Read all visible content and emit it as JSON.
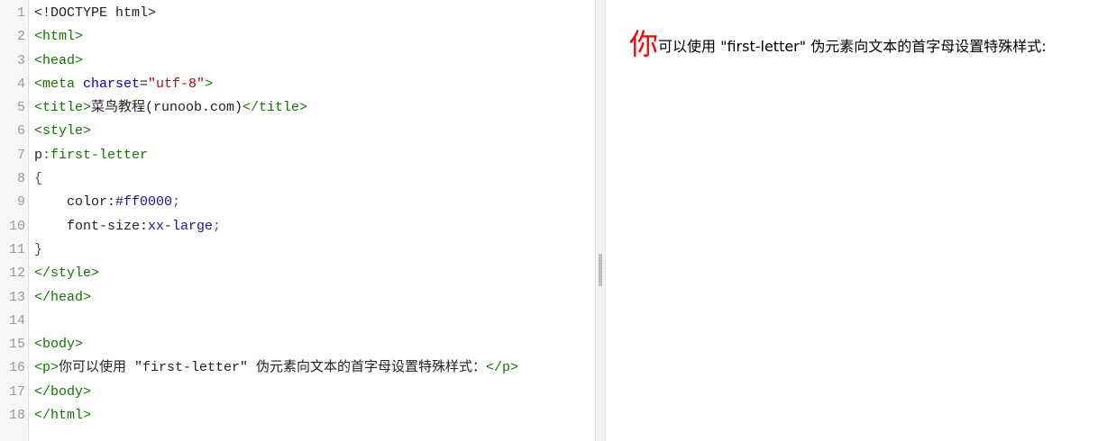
{
  "editor": {
    "line_numbers": [
      "1",
      "2",
      "3",
      "4",
      "5",
      "6",
      "7",
      "8",
      "9",
      "10",
      "11",
      "12",
      "13",
      "14",
      "15",
      "16",
      "17",
      "18"
    ],
    "lines": {
      "l1": {
        "text": "<!DOCTYPE html>"
      },
      "l2": {
        "text": "<html>"
      },
      "l3": {
        "text": "<head>"
      },
      "l4": {
        "tag_open": "<meta ",
        "attr": "charset",
        "eq": "=",
        "value": "\"utf-8\"",
        "tag_close": ">"
      },
      "l5": {
        "tag_open": "<title>",
        "content": "菜鸟教程(runoob.com)",
        "tag_close": "</title>"
      },
      "l6": {
        "text": "<style>"
      },
      "l7": {
        "selector": "p",
        "pseudo": ":first-letter"
      },
      "l8": {
        "text": "{"
      },
      "l9": {
        "indent": "    ",
        "prop": "color:",
        "value": "#ff0000",
        "semi": ";"
      },
      "l10": {
        "indent": "    ",
        "prop": "font-size:",
        "value": "xx-large",
        "semi": ";"
      },
      "l11": {
        "text": "}"
      },
      "l12": {
        "text": "</style>"
      },
      "l13": {
        "text": "</head>"
      },
      "l14": {
        "text": ""
      },
      "l15": {
        "text": "<body>"
      },
      "l16": {
        "tag_open": "<p>",
        "content": "你可以使用 \"first-letter\" 伪元素向文本的首字母设置特殊样式：",
        "tag_close": "</p>"
      },
      "l17": {
        "text": "</body>"
      },
      "l18": {
        "text": "</html>"
      }
    }
  },
  "preview": {
    "first_letter": "你",
    "rest": "可以使用 \"first-letter\" 伪元素向文本的首字母设置特殊样式:",
    "first_letter_color": "#ff0000"
  },
  "colors": {
    "tag": "#117700",
    "attribute": "#0000cc",
    "string": "#aa1111",
    "value": "#221199",
    "gutter_bg": "#f7f7f7"
  }
}
